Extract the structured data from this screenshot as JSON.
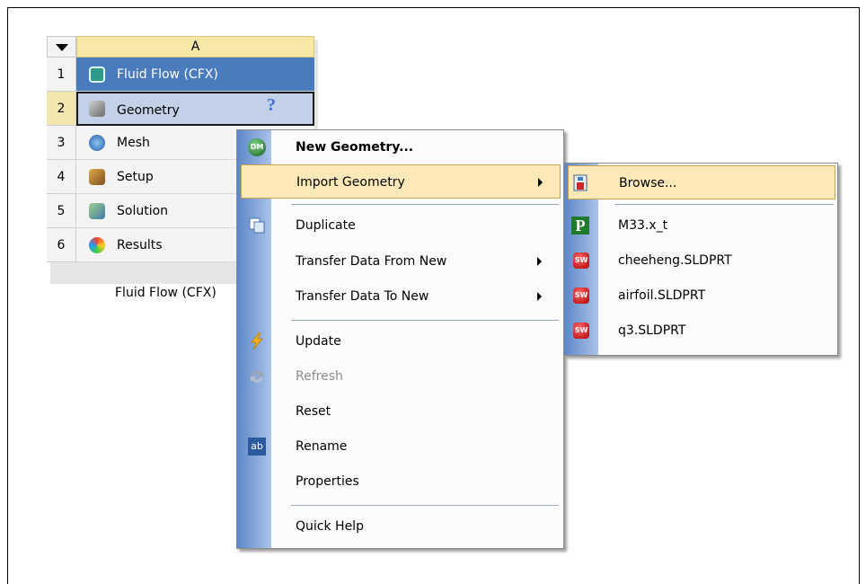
{
  "system": {
    "column_header": "A",
    "caption": "Fluid Flow (CFX)",
    "rows": [
      {
        "num": "1",
        "label": "Fluid Flow (CFX)",
        "icon": "cfx-icon"
      },
      {
        "num": "2",
        "label": "Geometry",
        "icon": "geometry-icon",
        "status": "?"
      },
      {
        "num": "3",
        "label": "Mesh",
        "icon": "mesh-icon"
      },
      {
        "num": "4",
        "label": "Setup",
        "icon": "setup-icon"
      },
      {
        "num": "5",
        "label": "Solution",
        "icon": "solution-icon"
      },
      {
        "num": "6",
        "label": "Results",
        "icon": "results-icon"
      }
    ]
  },
  "context_menu": {
    "items": [
      {
        "label": "New Geometry...",
        "icon": "dm-icon",
        "icon_text": "DM"
      },
      {
        "label": "Import Geometry"
      },
      {
        "label": "Duplicate",
        "icon": "duplicate-icon"
      },
      {
        "label": "Transfer Data From New"
      },
      {
        "label": "Transfer Data To New"
      },
      {
        "label": "Update",
        "icon": "lightning-icon"
      },
      {
        "label": "Refresh",
        "icon": "refresh-icon"
      },
      {
        "label": "Reset"
      },
      {
        "label": "Rename",
        "icon": "rename-icon",
        "icon_text": "ab"
      },
      {
        "label": "Properties"
      },
      {
        "label": "Quick Help"
      }
    ]
  },
  "import_submenu": {
    "items": [
      {
        "label": "Browse...",
        "icon": "browse-icon"
      },
      {
        "label": "M33.x_t",
        "icon": "parasolid-icon",
        "icon_text": "P"
      },
      {
        "label": "cheeheng.SLDPRT",
        "icon": "solidworks-icon",
        "icon_text": "SW"
      },
      {
        "label": "airfoil.SLDPRT",
        "icon": "solidworks-icon",
        "icon_text": "SW"
      },
      {
        "label": "q3.SLDPRT",
        "icon": "solidworks-icon",
        "icon_text": "SW"
      }
    ]
  },
  "colors": {
    "menu_highlight": "#fde9b7",
    "gutter": "#5d86c7",
    "system_header": "#4a7bbd",
    "column_header": "#f7e8a8"
  }
}
